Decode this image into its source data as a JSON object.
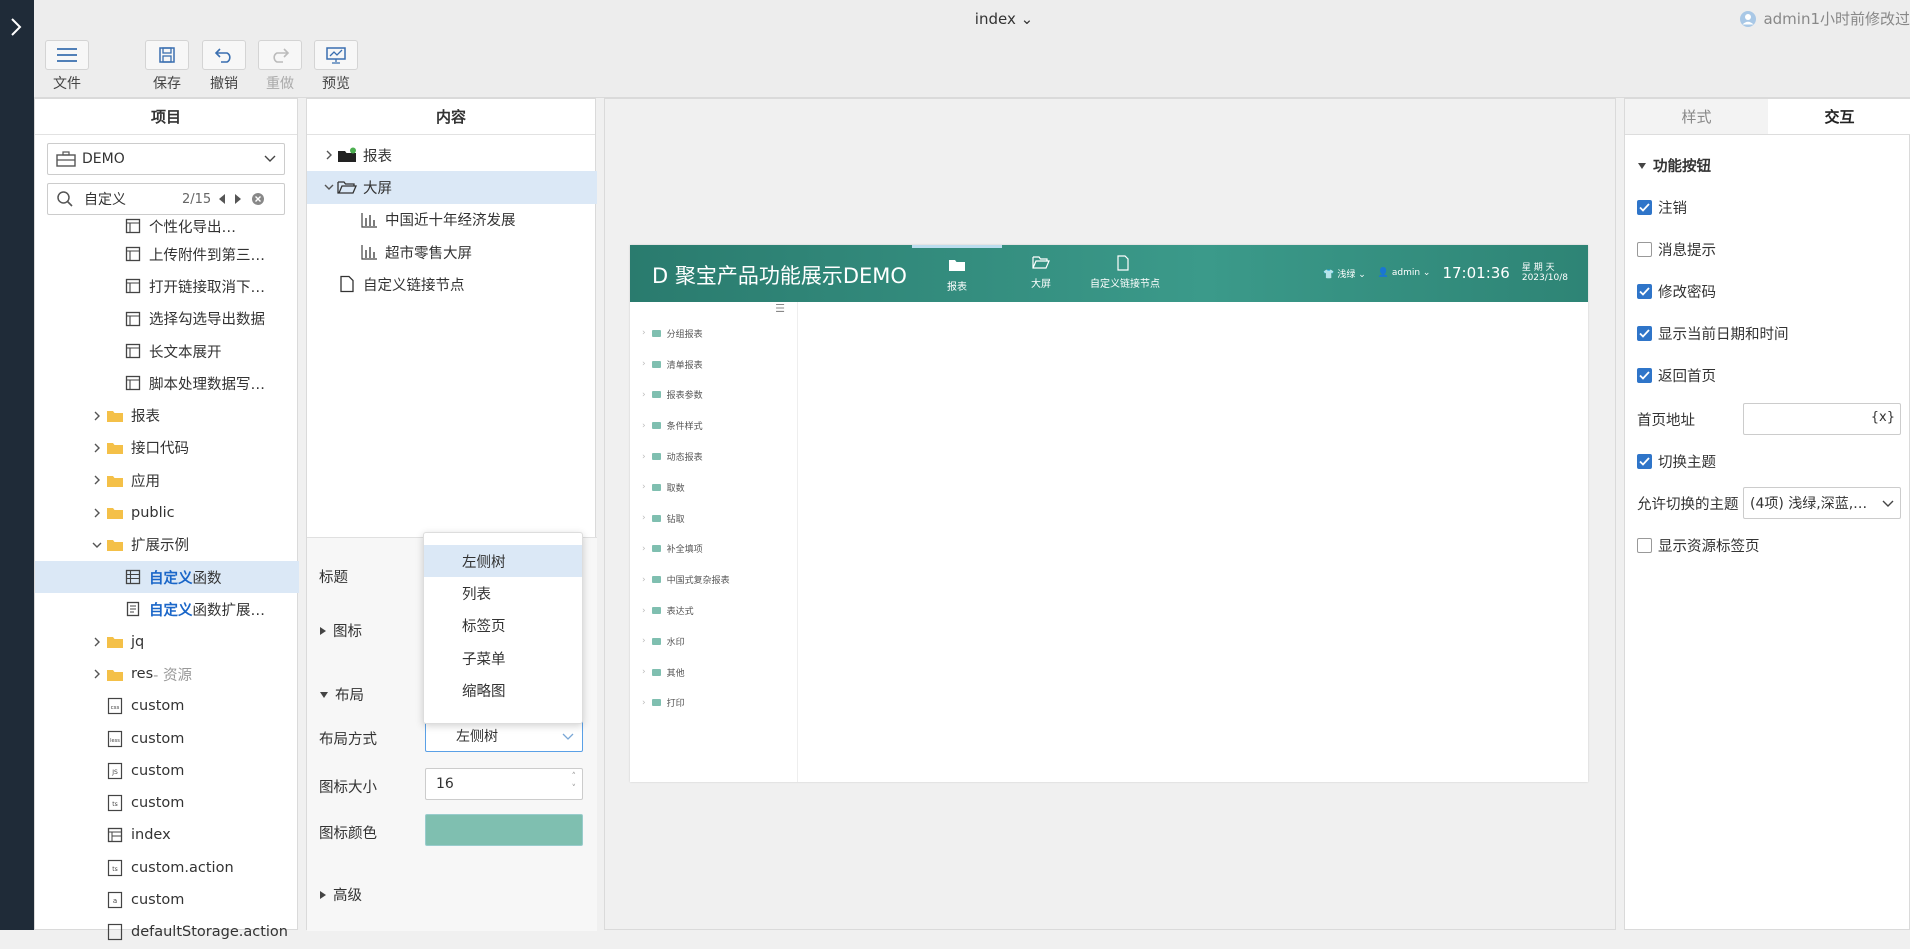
{
  "app": {
    "doc_title": "index",
    "user_status": "admin1小时前修改过"
  },
  "toolbar": {
    "file": "文件",
    "save": "保存",
    "undo": "撤销",
    "redo": "重做",
    "preview": "预览"
  },
  "project": {
    "header": "项目",
    "select_value": "DEMO",
    "search_value": "自定义",
    "search_count": "2/15",
    "rows": [
      {
        "label": "个性化导出…"
      },
      {
        "label": "上传附件到第三…"
      },
      {
        "label": "打开链接取消下…"
      },
      {
        "label": "选择勾选导出数据"
      },
      {
        "label": "长文本展开"
      },
      {
        "label": "脚本处理数据写…"
      },
      {
        "label": "报表"
      },
      {
        "label": "接口代码"
      },
      {
        "label": "应用"
      },
      {
        "label": "public"
      },
      {
        "label": "扩展示例"
      },
      {
        "hl": "自定义",
        "rest": "函数"
      },
      {
        "hl": "自定义",
        "rest": "函数扩展…"
      },
      {
        "label": "jq"
      },
      {
        "label": "res",
        "muted": " - 资源"
      },
      {
        "label": "custom"
      },
      {
        "label": "custom"
      },
      {
        "label": "custom"
      },
      {
        "label": "custom"
      },
      {
        "label": "index"
      },
      {
        "label": "custom.action"
      },
      {
        "label": "custom"
      },
      {
        "label": "defaultStorage.action"
      }
    ]
  },
  "content": {
    "header": "内容",
    "tree": [
      {
        "label": "报表"
      },
      {
        "label": "大屏"
      },
      {
        "label": "中国近十年经济发展"
      },
      {
        "label": "超市零售大屏"
      },
      {
        "label": "自定义链接节点"
      }
    ],
    "props": {
      "title_label": "标题",
      "icon_section": "图标",
      "layout_section": "布局",
      "layout_mode_label": "布局方式",
      "layout_mode_value": "左侧树",
      "icon_size_label": "图标大小",
      "icon_size_value": "16",
      "icon_color_label": "图标颜色",
      "icon_color": "#7fbfb0",
      "advanced_section": "高级"
    },
    "dropdown_options": [
      "左侧树",
      "列表",
      "标签页",
      "子菜单",
      "缩略图"
    ]
  },
  "preview": {
    "logo_letter": "D",
    "title": "聚宝产品功能展示DEMO",
    "nav": [
      {
        "label": "报表"
      },
      {
        "label": "大屏"
      },
      {
        "label": "自定义链接节点"
      }
    ],
    "theme": "浅绿",
    "user": "admin",
    "time": "17:01:36",
    "weekday": "星 期 天",
    "date": "2023/10/8",
    "menu_items": [
      "分组报表",
      "清单报表",
      "报表参数",
      "条件样式",
      "动态报表",
      "取数",
      "钻取",
      "补全填项",
      "中国式复杂报表",
      "表达式",
      "水印",
      "其他",
      "打印"
    ],
    "header_color": "#2e8475"
  },
  "right": {
    "tabs": [
      "样式",
      "交互"
    ],
    "section": "功能按钮",
    "logout": "注销",
    "message": "消息提示",
    "change_pwd": "修改密码",
    "show_datetime": "显示当前日期和时间",
    "back_home": "返回首页",
    "home_url_label": "首页地址",
    "home_url_value": "",
    "var_icon": "{x}",
    "switch_theme": "切换主题",
    "allowed_themes_label": "允许切换的主题",
    "allowed_themes_value": "(4项) 浅绿,深蓝,…",
    "show_res_tab": "显示资源标签页"
  }
}
